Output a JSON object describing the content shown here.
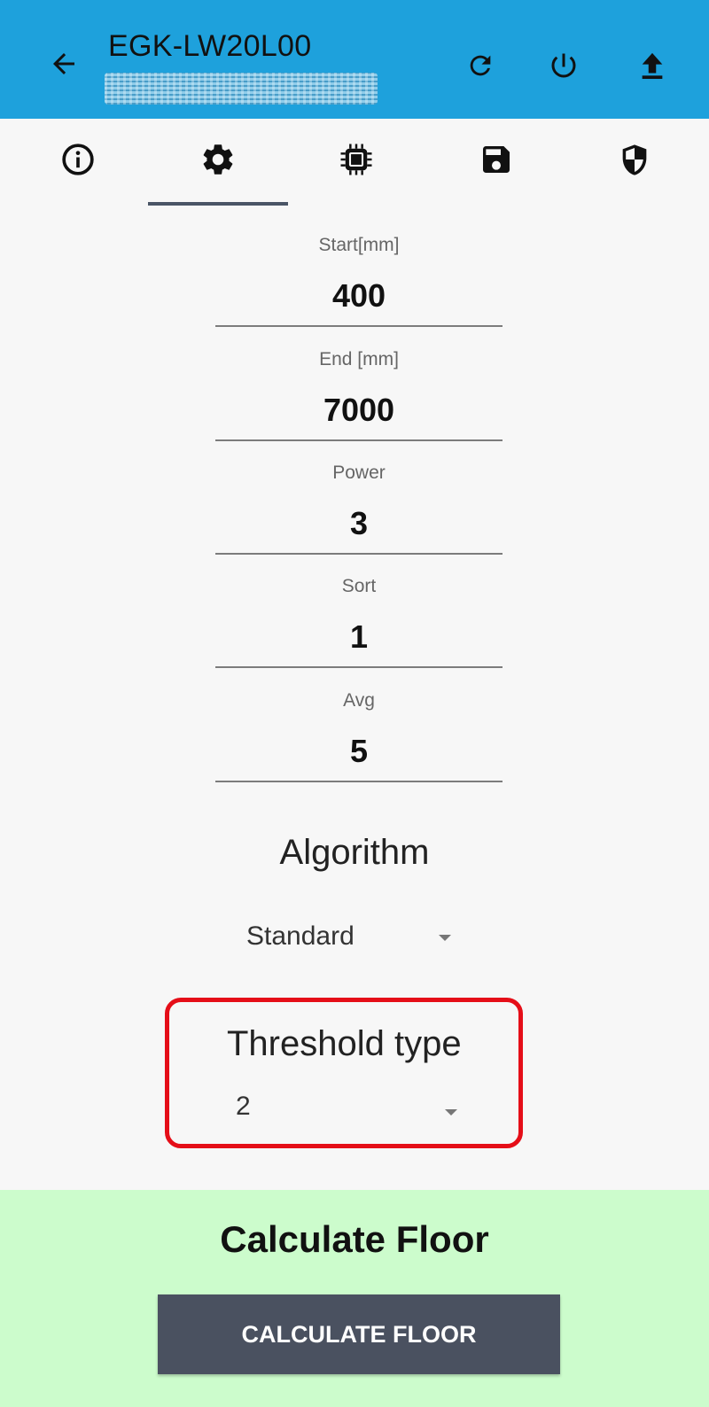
{
  "app_bar": {
    "title": "EGK-LW20L00",
    "subtitle": "",
    "icons": {
      "back": "arrow-left-icon",
      "refresh": "refresh-icon",
      "power": "power-icon",
      "upload": "upload-icon"
    }
  },
  "tabs": [
    {
      "icon": "info-icon",
      "selected": false
    },
    {
      "icon": "gear-icon",
      "selected": true
    },
    {
      "icon": "chip-icon",
      "selected": false
    },
    {
      "icon": "save-icon",
      "selected": false
    },
    {
      "icon": "shield-icon",
      "selected": false
    }
  ],
  "fields": [
    {
      "label": "Start[mm]",
      "value": "400"
    },
    {
      "label": "End [mm]",
      "value": "7000"
    },
    {
      "label": "Power",
      "value": "3"
    },
    {
      "label": "Sort",
      "value": "1"
    },
    {
      "label": "Avg",
      "value": "5"
    }
  ],
  "algorithm": {
    "title": "Algorithm",
    "selected": "Standard"
  },
  "threshold": {
    "title": "Threshold type",
    "selected": "2",
    "highlight_color": "#e50e18"
  },
  "calculate": {
    "heading": "Calculate Floor",
    "button_label": "CALCULATE FLOOR"
  },
  "colors": {
    "app_bar": "#1ea1dc",
    "bottom_panel": "#ccfccc",
    "button": "#4a5160"
  }
}
